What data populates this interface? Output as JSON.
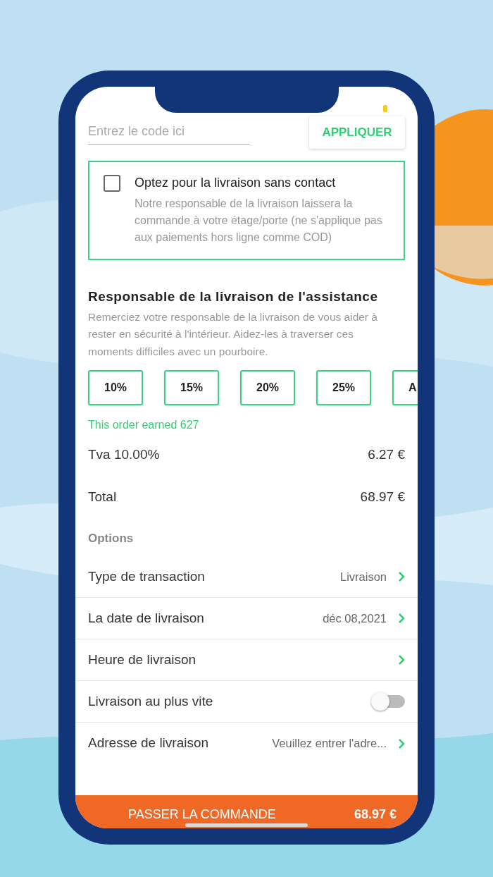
{
  "promo": {
    "placeholder": "Entrez le code ici",
    "apply_button": "APPLIQUER"
  },
  "contactless": {
    "title": "Optez pour la livraison sans contact",
    "description": "Notre responsable de la livraison laissera la commande à votre étage/porte (ne s'applique pas aux paiements hors ligne comme COD)",
    "checked": false
  },
  "tip": {
    "title": "Responsable de la livraison de l'assistance",
    "description": "Remerciez votre responsable de la livraison de vous aider à rester en sécurité à l'intérieur. Aidez-les à traverser ces moments difficiles avec un pourboire.",
    "options": [
      {
        "label": "10%",
        "selected": false
      },
      {
        "label": "15%",
        "selected": false
      },
      {
        "label": "20%",
        "selected": false
      },
      {
        "label": "25%",
        "selected": false
      },
      {
        "label": "A",
        "selected": false
      }
    ]
  },
  "earned": "This order earned 627",
  "summary": [
    {
      "label": "Tva 10.00%",
      "value": "6.27 €"
    },
    {
      "label": "Total",
      "value": "68.97 €"
    }
  ],
  "options": {
    "title": "Options",
    "items": [
      {
        "kind": "link",
        "label": "Type de transaction",
        "value": "Livraison"
      },
      {
        "kind": "link",
        "label": "La date de livraison",
        "value": "déc 08,2021"
      },
      {
        "kind": "link",
        "label": "Heure de livraison"
      },
      {
        "kind": "toggle",
        "label": "Livraison au plus vite",
        "on": false
      },
      {
        "kind": "link",
        "label": "Adresse de livraison",
        "value": "Veuillez entrer l'adre..."
      }
    ]
  },
  "order_bar": {
    "label": "PASSER LA COMMANDE",
    "total": "68.97 €"
  }
}
